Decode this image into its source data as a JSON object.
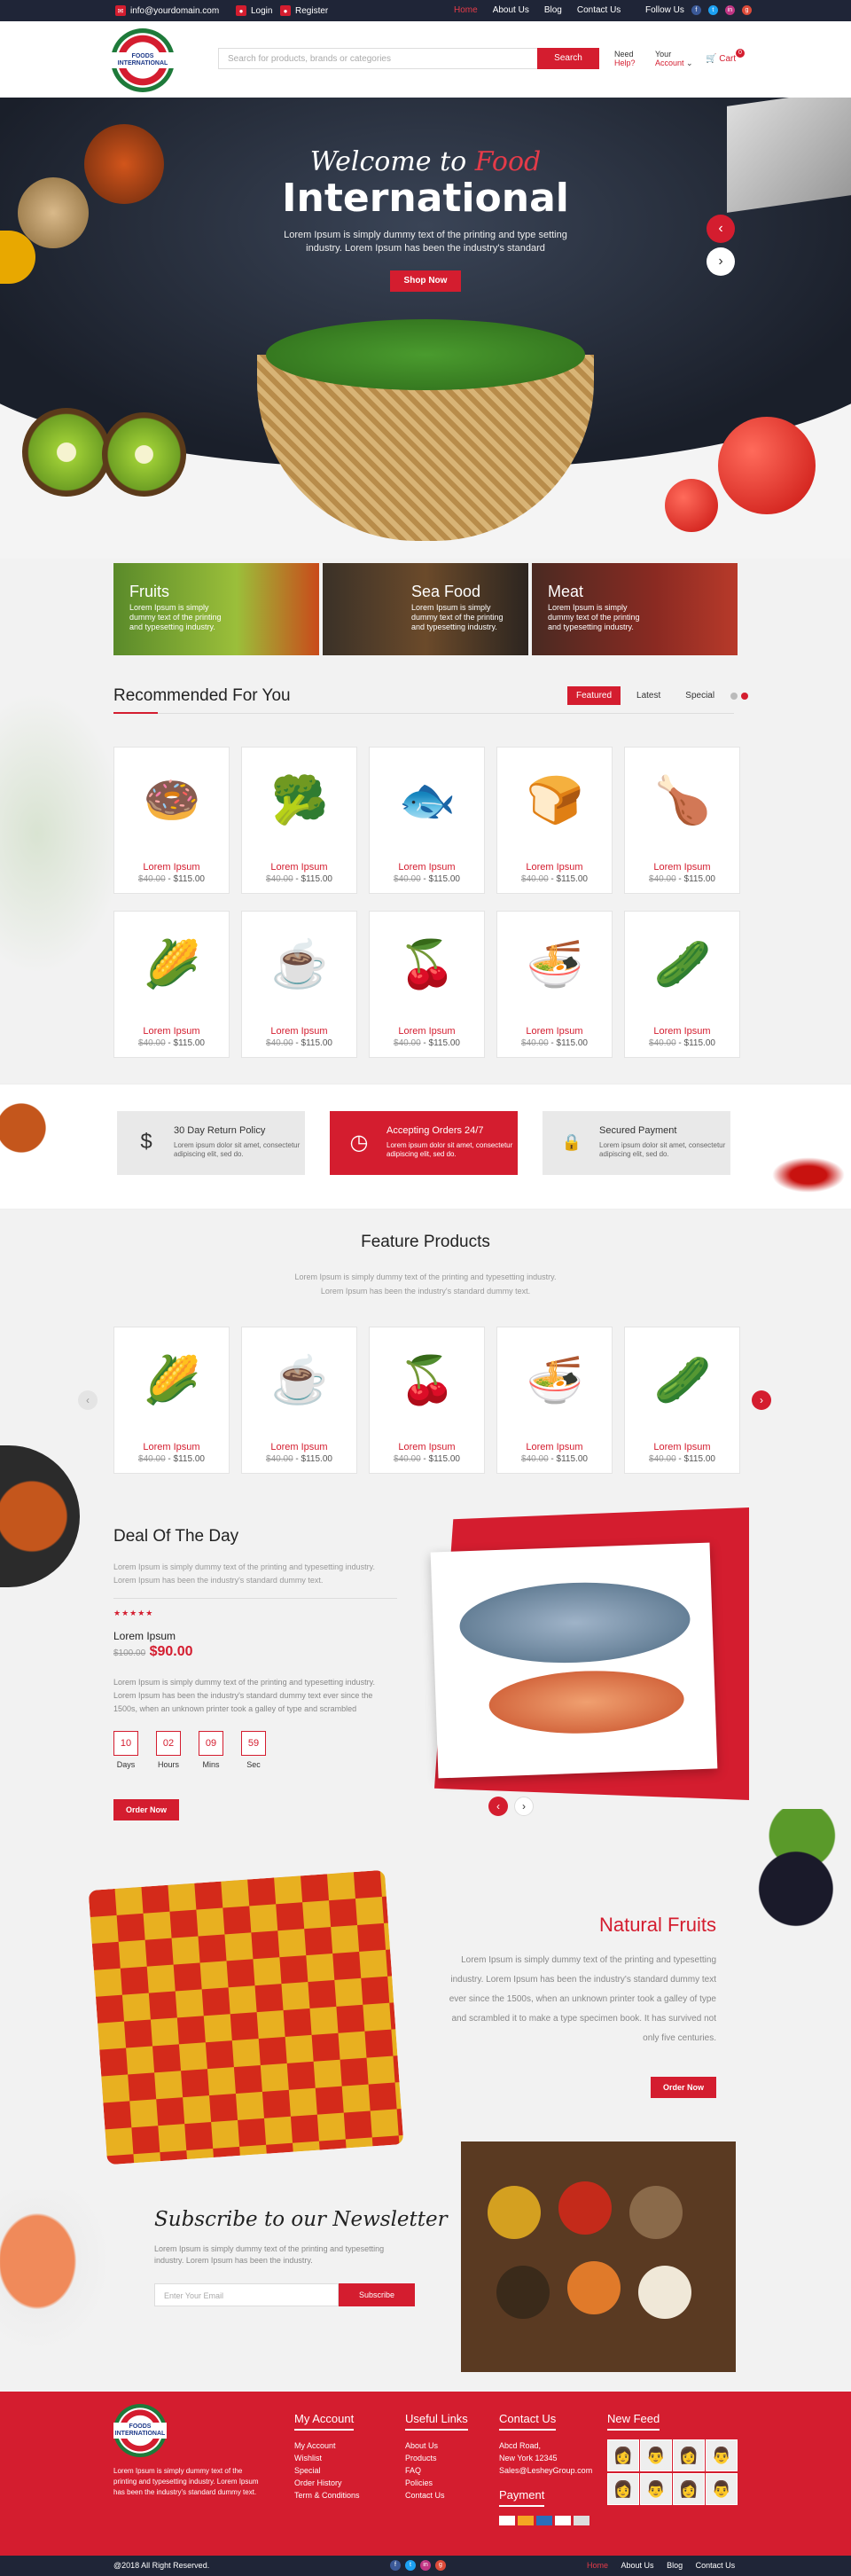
{
  "topbar": {
    "email": "info@yourdomain.com",
    "login": "Login",
    "register": "Register",
    "nav": [
      "Home",
      "About Us",
      "Blog",
      "Contact Us"
    ],
    "follow": "Follow Us",
    "social": [
      "f",
      "t",
      "in",
      "g"
    ]
  },
  "header": {
    "logo_text": "FOODS INTERNATIONAL",
    "search_placeholder": "Search for products, brands or categories",
    "search_button": "Search",
    "help_line1": "Need",
    "help_line2": "Help?",
    "account_line1": "Your",
    "account_line2": "Account",
    "cart": "Cart",
    "cart_count": "0"
  },
  "hero": {
    "welcome": "Welcome to",
    "food": "Food",
    "title": "International",
    "text": "Lorem Ipsum is simply dummy text of the printing and type setting industry. Lorem Ipsum has been the industry's standard",
    "button": "Shop Now",
    "prev": "‹",
    "next": "›"
  },
  "categories": [
    {
      "title": "Fruits",
      "text": "Lorem Ipsum is simply dummy text of the printing and typesetting industry."
    },
    {
      "title": "Sea Food",
      "text": "Lorem Ipsum is simply dummy text of the printing and typesetting industry."
    },
    {
      "title": "Meat",
      "text": "Lorem Ipsum is simply dummy text of the printing and typesetting industry."
    }
  ],
  "recommended": {
    "title": "Recommended For You",
    "tabs": [
      "Featured",
      "Latest",
      "Special"
    ]
  },
  "products": [
    {
      "name": "Lorem Ipsum",
      "old": "$40.00",
      "price": "$115.00",
      "icon": "🍩"
    },
    {
      "name": "Lorem Ipsum",
      "old": "$40.00",
      "price": "$115.00",
      "icon": "🥦"
    },
    {
      "name": "Lorem Ipsum",
      "old": "$40.00",
      "price": "$115.00",
      "icon": "🐟"
    },
    {
      "name": "Lorem Ipsum",
      "old": "$40.00",
      "price": "$115.00",
      "icon": "🍞"
    },
    {
      "name": "Lorem Ipsum",
      "old": "$40.00",
      "price": "$115.00",
      "icon": "🍗"
    },
    {
      "name": "Lorem Ipsum",
      "old": "$40.00",
      "price": "$115.00",
      "icon": "🌽"
    },
    {
      "name": "Lorem Ipsum",
      "old": "$40.00",
      "price": "$115.00",
      "icon": "☕"
    },
    {
      "name": "Lorem Ipsum",
      "old": "$40.00",
      "price": "$115.00",
      "icon": "🍒"
    },
    {
      "name": "Lorem Ipsum",
      "old": "$40.00",
      "price": "$115.00",
      "icon": "🍜"
    },
    {
      "name": "Lorem Ipsum",
      "old": "$40.00",
      "price": "$115.00",
      "icon": "🥒"
    }
  ],
  "features": [
    {
      "title": "30 Day Return Policy",
      "text": "Lorem ipsum dolor sit amet, consectetur adipiscing elit, sed do.",
      "icon": "$"
    },
    {
      "title": "Accepting Orders 24/7",
      "text": "Lorem ipsum dolor sit amet, consectetur adipiscing elit, sed do.",
      "icon": "◷"
    },
    {
      "title": "Secured Payment",
      "text": "Lorem ipsum dolor sit amet, consectetur adipiscing elit, sed do.",
      "icon": "🔒"
    }
  ],
  "feature_products": {
    "title": "Feature Products",
    "subtitle1": "Lorem Ipsum is simply dummy text of the printing and typesetting industry.",
    "subtitle2": "Lorem Ipsum has been the industry's standard dummy text.",
    "items": [
      {
        "name": "Lorem Ipsum",
        "old": "$40.00",
        "price": "$115.00",
        "icon": "🌽"
      },
      {
        "name": "Lorem Ipsum",
        "old": "$40.00",
        "price": "$115.00",
        "icon": "☕"
      },
      {
        "name": "Lorem Ipsum",
        "old": "$40.00",
        "price": "$115.00",
        "icon": "🍒"
      },
      {
        "name": "Lorem Ipsum",
        "old": "$40.00",
        "price": "$115.00",
        "icon": "🍜"
      },
      {
        "name": "Lorem Ipsum",
        "old": "$40.00",
        "price": "$115.00",
        "icon": "🥒"
      }
    ]
  },
  "deal": {
    "title": "Deal Of The Day",
    "intro": "Lorem Ipsum is simply dummy text of the printing and typesetting industry. Lorem Ipsum has been the industry's standard dummy text.",
    "stars": "★★★★★",
    "product": "Lorem Ipsum",
    "old": "$100.00",
    "price": "$90.00",
    "desc": "Lorem Ipsum is simply dummy text of the printing and typesetting industry. Lorem Ipsum has been the industry's standard dummy text ever since the 1500s, when an unknown printer took a galley of type and scrambled",
    "timer": [
      {
        "value": "10",
        "label": "Days"
      },
      {
        "value": "02",
        "label": "Hours"
      },
      {
        "value": "09",
        "label": "Mins"
      },
      {
        "value": "59",
        "label": "Sec"
      }
    ],
    "button": "Order Now"
  },
  "natural": {
    "title": "Natural Fruits",
    "text": "Lorem Ipsum is simply dummy text of the printing and typesetting industry. Lorem Ipsum has been the industry's standard dummy text ever since the 1500s, when an unknown printer took a galley of type and scrambled it to make a type specimen book. It has survived not only five centuries.",
    "button": "Order Now"
  },
  "newsletter": {
    "title": "Subscribe to our Newsletter",
    "text": "Lorem Ipsum is simply dummy text of the printing and typesetting industry. Lorem Ipsum has been the industry.",
    "placeholder": "Enter Your Email",
    "button": "Subscribe"
  },
  "footer": {
    "about": "Lorem Ipsum is simply dummy text of the printing and typesetting industry. Lorem Ipsum has been the industry's standard dummy text.",
    "my_account": {
      "title": "My Account",
      "links": [
        "My Account",
        "Wishlist",
        "Special",
        "Order History",
        "Term & Conditions"
      ]
    },
    "useful": {
      "title": "Useful Links",
      "links": [
        "About Us",
        "Products",
        "FAQ",
        "Policies",
        "Contact Us"
      ]
    },
    "contact": {
      "title": "Contact Us",
      "lines": [
        "Abcd Road,",
        "New York 12345",
        "Sales@LesheyGroup.com"
      ]
    },
    "payment_title": "Payment",
    "newfeed_title": "New Feed",
    "copyright": "@2018 All Right Reserved.",
    "bottom_nav": [
      "Home",
      "About Us",
      "Blog",
      "Contact Us"
    ]
  },
  "colors": {
    "accent": "#d41d2f",
    "dark": "#1f2537"
  }
}
